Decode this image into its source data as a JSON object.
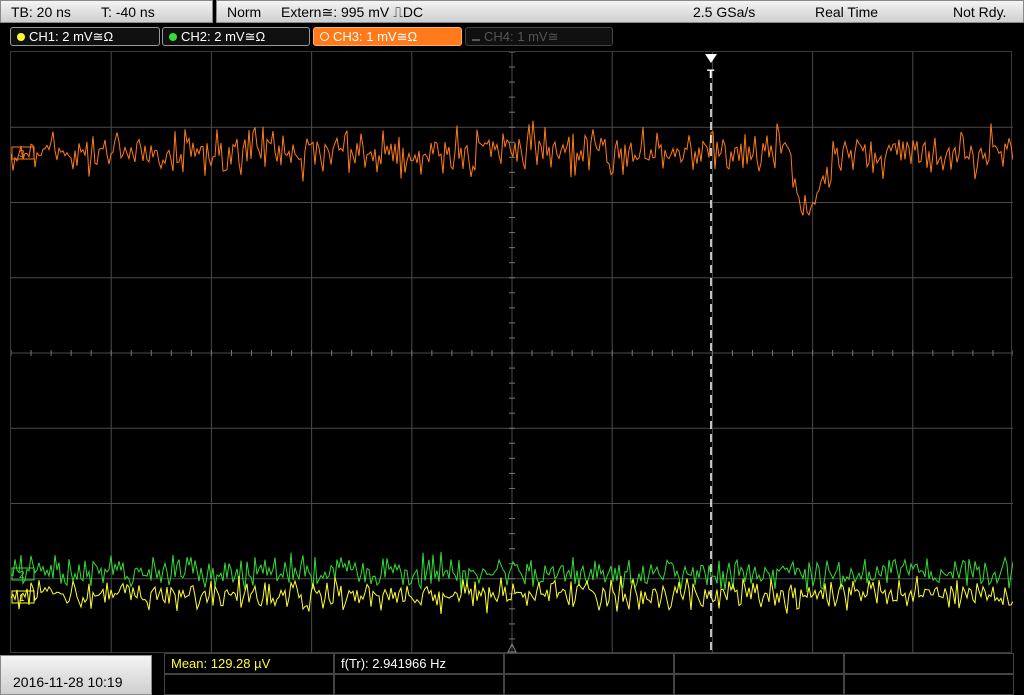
{
  "timebase": {
    "tb": "TB: 20 ns",
    "t": "T: -40 ns"
  },
  "status": {
    "mode": "Norm",
    "trigger": "Extern≅: 995 mV ⎍DC",
    "sample_rate": "2.5 GSa/s",
    "acq": "Real Time",
    "state": "Not Rdy."
  },
  "channels": [
    {
      "label": "CH1: 2 mV≅Ω",
      "color": "#ffff30",
      "state": "on"
    },
    {
      "label": "CH2: 2 mV≅Ω",
      "color": "#33dd33",
      "state": "on"
    },
    {
      "label": "CH3: 1 mV≅Ω",
      "color": "#ff7a1a",
      "state": "active"
    },
    {
      "label": "CH4: 1 mV≅",
      "color": "#555555",
      "state": "off"
    }
  ],
  "markers": {
    "trigger_label": "T",
    "ch3": "3",
    "ch2": "2",
    "ch1": "1"
  },
  "datetime": "2016-11-28 10:19",
  "measurements": {
    "mean": "Mean: 129.28 µV",
    "freq": "f(Tr): 2.941966 Hz"
  },
  "colors": {
    "ch1": "#ffff30",
    "ch2": "#33dd33",
    "ch3": "#ff7a1a",
    "grid": "#4a4a4a",
    "trigger_line": "#ffffff"
  }
}
